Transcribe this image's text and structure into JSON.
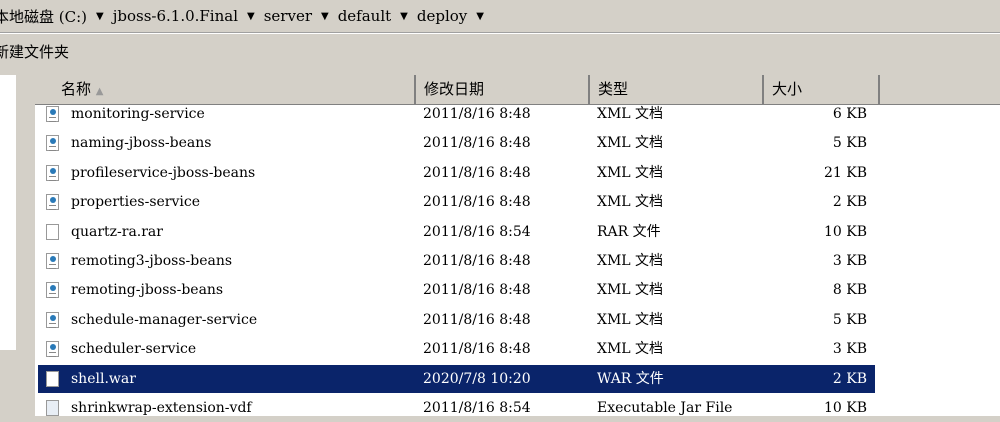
{
  "breadcrumb": [
    "本地磁盘 (C:)",
    "jboss-6.1.0.Final",
    "server",
    "default",
    "deploy"
  ],
  "toolbar": {
    "new_folder": "新建文件夹"
  },
  "columns": {
    "name": "名称",
    "date": "修改日期",
    "type": "类型",
    "size": "大小"
  },
  "files": [
    {
      "name": "monitoring-service",
      "date": "2011/8/16 8:48",
      "type": "XML 文档",
      "size": "6 KB",
      "icon": "xml"
    },
    {
      "name": "naming-jboss-beans",
      "date": "2011/8/16 8:48",
      "type": "XML 文档",
      "size": "5 KB",
      "icon": "xml"
    },
    {
      "name": "profileservice-jboss-beans",
      "date": "2011/8/16 8:48",
      "type": "XML 文档",
      "size": "21 KB",
      "icon": "xml"
    },
    {
      "name": "properties-service",
      "date": "2011/8/16 8:48",
      "type": "XML 文档",
      "size": "2 KB",
      "icon": "xml"
    },
    {
      "name": "quartz-ra.rar",
      "date": "2011/8/16 8:54",
      "type": "RAR 文件",
      "size": "10 KB",
      "icon": "file"
    },
    {
      "name": "remoting3-jboss-beans",
      "date": "2011/8/16 8:48",
      "type": "XML 文档",
      "size": "3 KB",
      "icon": "xml"
    },
    {
      "name": "remoting-jboss-beans",
      "date": "2011/8/16 8:48",
      "type": "XML 文档",
      "size": "8 KB",
      "icon": "xml"
    },
    {
      "name": "schedule-manager-service",
      "date": "2011/8/16 8:48",
      "type": "XML 文档",
      "size": "5 KB",
      "icon": "xml"
    },
    {
      "name": "scheduler-service",
      "date": "2011/8/16 8:48",
      "type": "XML 文档",
      "size": "3 KB",
      "icon": "xml"
    },
    {
      "name": "shell.war",
      "date": "2020/7/8 10:20",
      "type": "WAR 文件",
      "size": "2 KB",
      "icon": "file",
      "selected": true
    },
    {
      "name": "shrinkwrap-extension-vdf",
      "date": "2011/8/16 8:54",
      "type": "Executable Jar File",
      "size": "10 KB",
      "icon": "jar"
    }
  ]
}
